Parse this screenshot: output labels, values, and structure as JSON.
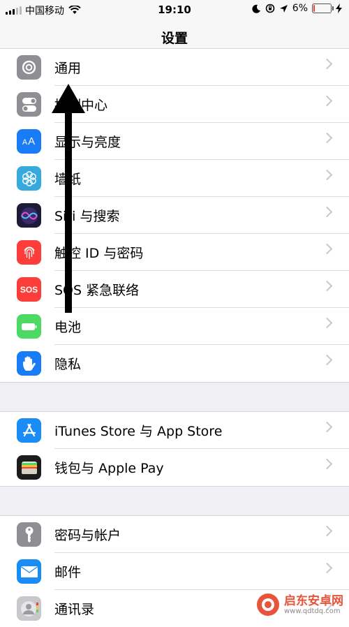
{
  "status_bar": {
    "carrier": "中国移动",
    "time": "19:10",
    "battery": "6%",
    "battery_color": "#ff3b30"
  },
  "nav": {
    "title": "设置"
  },
  "groups": [
    {
      "items": [
        {
          "label": "通用",
          "icon": "gear-icon",
          "color": "#8e8e93"
        },
        {
          "label": "控制中心",
          "icon": "toggle-switches-icon",
          "color": "#8e8e93"
        },
        {
          "label": "显示与亮度",
          "icon": "text-size-aa-icon",
          "color": "#1a7cf5"
        },
        {
          "label": "墙纸",
          "icon": "flower-icon",
          "color": "#36aadc"
        },
        {
          "label": "Siri 与搜索",
          "icon": "siri-icon",
          "color": "#1c1c3a"
        },
        {
          "label": "触控 ID 与密码",
          "icon": "fingerprint-icon",
          "color": "#fc3d39"
        },
        {
          "label": "SOS 紧急联络",
          "icon": "sos-icon",
          "color": "#fc3d39"
        },
        {
          "label": "电池",
          "icon": "battery-icon",
          "color": "#4cd964"
        },
        {
          "label": "隐私",
          "icon": "hand-icon",
          "color": "#1a7cf5"
        }
      ]
    },
    {
      "items": [
        {
          "label": "iTunes Store 与 App Store",
          "icon": "app-store-icon",
          "color": "#1a8cf5"
        },
        {
          "label": "钱包与 Apple Pay",
          "icon": "wallet-icon",
          "color": "#1c1c1e"
        }
      ]
    },
    {
      "items": [
        {
          "label": "密码与帐户",
          "icon": "key-icon",
          "color": "#8e8e93"
        },
        {
          "label": "邮件",
          "icon": "mail-icon",
          "color": "#1a8cf5"
        },
        {
          "label": "通讯录",
          "icon": "contacts-icon",
          "color": "#b8b8bd"
        }
      ]
    }
  ],
  "watermark": {
    "name": "启东安卓网",
    "url": "www.qdtdq.com"
  }
}
